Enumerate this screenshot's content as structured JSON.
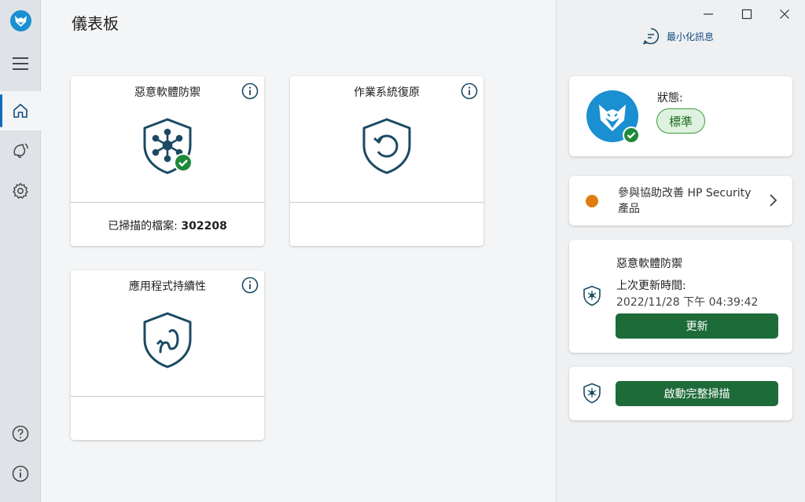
{
  "page": {
    "title": "儀表板"
  },
  "sidebar": {
    "items": [
      {
        "name": "menu",
        "icon": "hamburger-icon"
      },
      {
        "name": "home",
        "icon": "home-icon",
        "active": true
      },
      {
        "name": "notifications",
        "icon": "notification-icon"
      },
      {
        "name": "settings",
        "icon": "gear-icon"
      },
      {
        "name": "help",
        "icon": "help-icon"
      },
      {
        "name": "about",
        "icon": "info-icon"
      }
    ]
  },
  "cards": [
    {
      "title": "惡意軟體防禦",
      "icon": "network-shield-icon",
      "footer_label": "已掃描的檔案: ",
      "footer_value": "302208"
    },
    {
      "title": "作業系統復原",
      "icon": "restore-shield-icon"
    },
    {
      "title": "應用程式持續性",
      "icon": "persistence-shield-icon"
    }
  ],
  "right_panel": {
    "minimize_label": "最小化訊息",
    "status": {
      "label": "狀態:",
      "badge": "標準"
    },
    "improve": {
      "text": "參與協助改善 HP Security 產品"
    },
    "malware": {
      "title": "惡意軟體防禦",
      "last_update_label": "上次更新時間:",
      "last_update_value": "2022/11/28 下午 04:39:42",
      "update_button": "更新"
    },
    "scan": {
      "button": "啟動完整掃描"
    }
  },
  "colors": {
    "accent": "#0f6cbd",
    "brand": "#1a8fd1",
    "green_button": "#1e6b3a",
    "shield_stroke": "#1b4a63",
    "check_green": "#1e8a3a",
    "orange": "#e07d10"
  }
}
